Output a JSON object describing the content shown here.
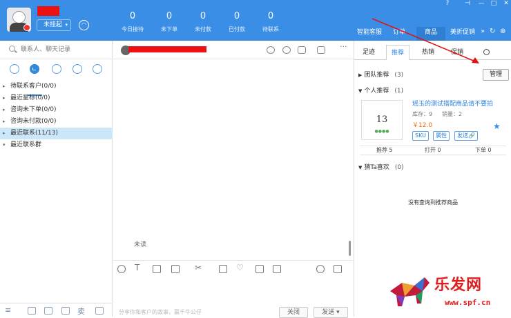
{
  "header": {
    "status_label": "未挂起",
    "stats": [
      {
        "value": "0",
        "label": "今日接待"
      },
      {
        "value": "0",
        "label": "未下单"
      },
      {
        "value": "0",
        "label": "未付款"
      },
      {
        "value": "0",
        "label": "已付款"
      },
      {
        "value": "0",
        "label": "待联系"
      }
    ],
    "tabs": [
      "智能客服",
      "订单",
      "商品",
      "美折促销"
    ],
    "more": "»"
  },
  "left": {
    "search_placeholder": "联系人、聊天记录",
    "tree": [
      {
        "label": "待联系客户(0/0)",
        "arrow": "▸"
      },
      {
        "label": "最近星标(0/0)",
        "arrow": "▸"
      },
      {
        "label": "咨询未下单(0/0)",
        "arrow": "▸"
      },
      {
        "label": "咨询未付款(0/0)",
        "arrow": "▸"
      },
      {
        "label": "最近联系(11/13)",
        "arrow": "▸"
      },
      {
        "label": "最近联系群",
        "arrow": "▾"
      }
    ],
    "bottom_text": "卖"
  },
  "chat": {
    "unread": "未读",
    "hint": "分享你和客户的故事，赢千牛公仔",
    "close_label": "关闭",
    "send_label": "发送 ▾",
    "more": "···"
  },
  "right": {
    "tabs": [
      "足迹",
      "推荐",
      "热销",
      "促销"
    ],
    "sections": [
      {
        "title": "团队推荐",
        "count": "(3)",
        "tri": "▶"
      },
      {
        "title": "个人推荐",
        "count": "(1)",
        "tri": "▼"
      },
      {
        "title": "猜Ta喜欢",
        "count": "(0)",
        "tri": "▼"
      }
    ],
    "manage_label": "管理",
    "product": {
      "image_text": "13",
      "image_sub": "●●●●",
      "title": "瑶玉的测试搭配商品请不要拍",
      "stock": "库存：9",
      "sold": "销量：2",
      "price": "￥12.0",
      "tags": [
        "SKU",
        "属性",
        "发送🔗"
      ]
    },
    "stats": {
      "recommend": "推荐 5",
      "open": "打开 0",
      "order": "下单 0"
    },
    "empty": "没有查询到推荐商品"
  },
  "watermark": {
    "cn": "乐发网",
    "url": "www.spf.cn"
  },
  "colors": {
    "header": "#3a8ee6",
    "accent": "#2f88e0",
    "redact": "#ee1111",
    "price": "#e96a00"
  }
}
